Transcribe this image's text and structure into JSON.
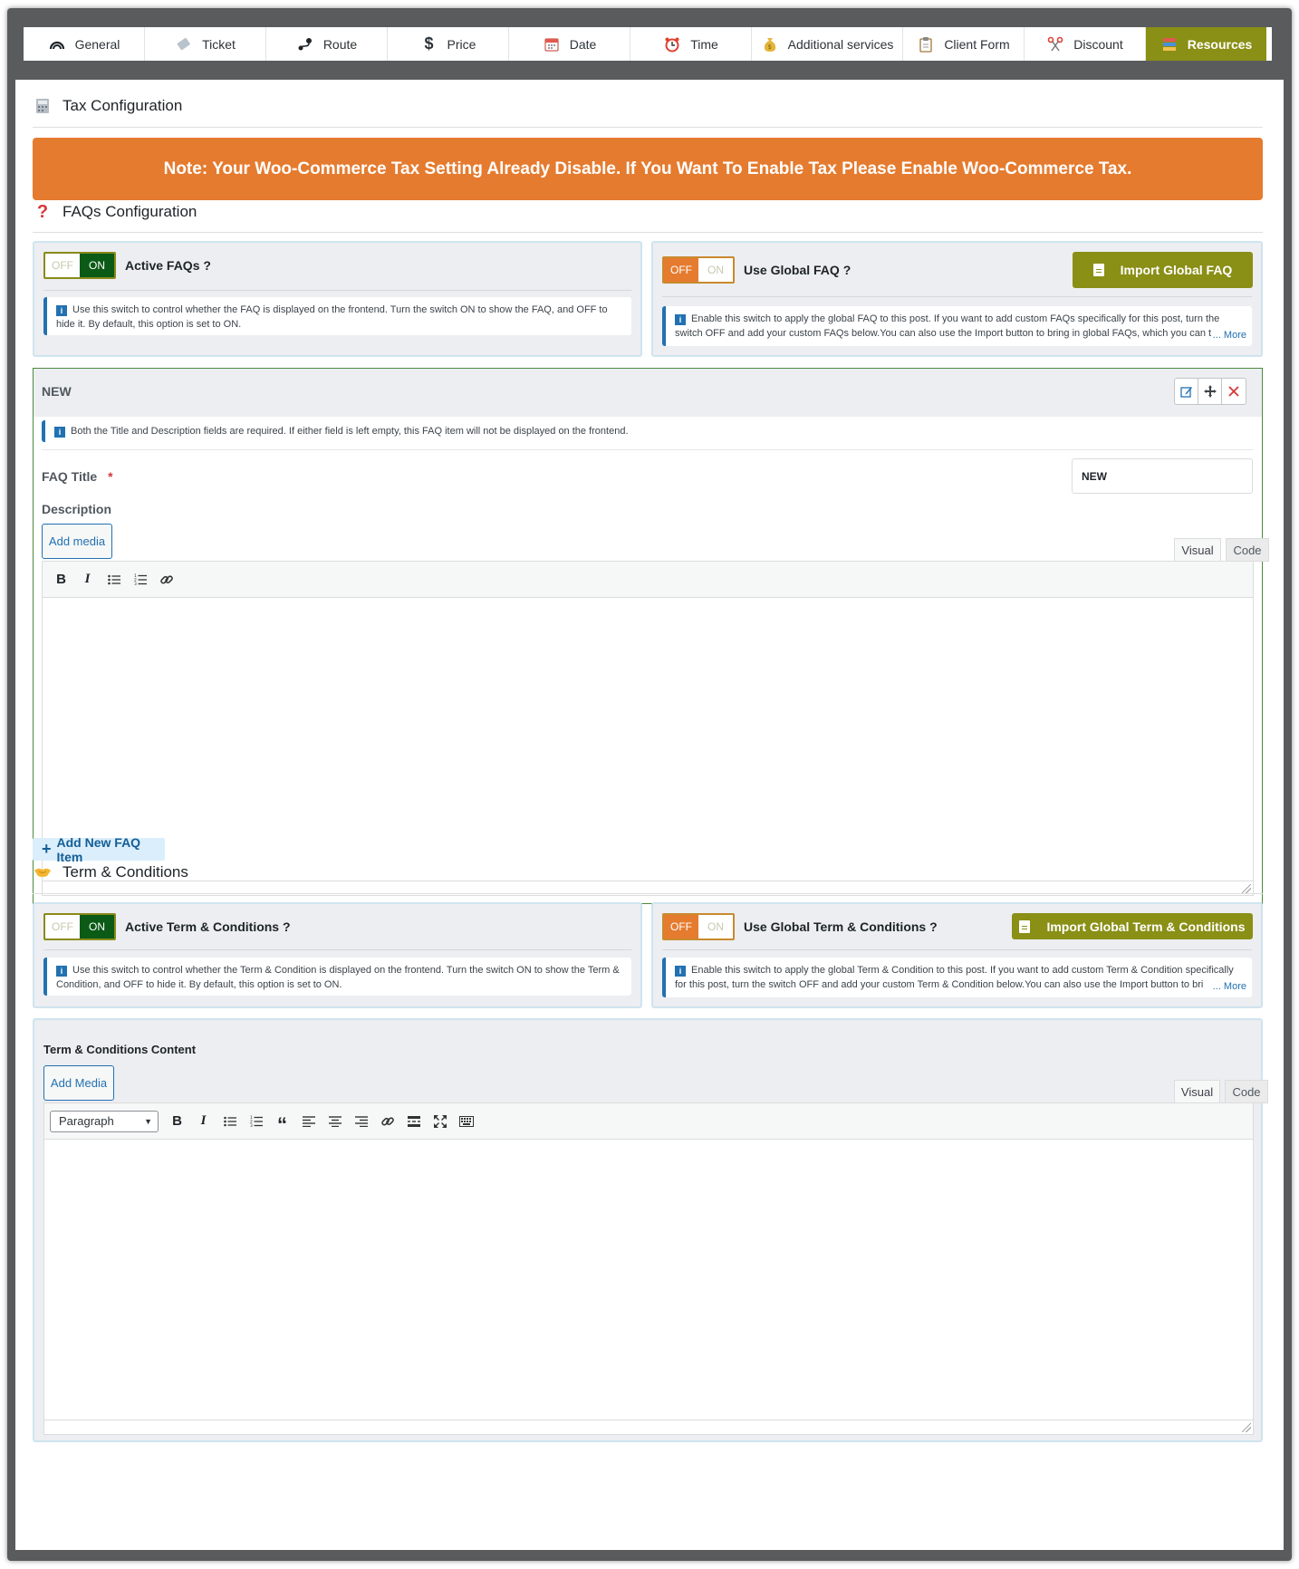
{
  "tabs": [
    {
      "label": "General",
      "icon": "speedometer-icon"
    },
    {
      "label": "Ticket",
      "icon": "ticket-icon"
    },
    {
      "label": "Route",
      "icon": "route-icon"
    },
    {
      "label": "Price",
      "icon": "dollar-icon"
    },
    {
      "label": "Date",
      "icon": "calendar-icon"
    },
    {
      "label": "Time",
      "icon": "alarm-clock-icon"
    },
    {
      "label": "Additional services",
      "icon": "money-bag-icon"
    },
    {
      "label": "Client Form",
      "icon": "clipboard-icon"
    },
    {
      "label": "Discount",
      "icon": "scissors-icon"
    },
    {
      "label": "Resources",
      "icon": "books-icon"
    }
  ],
  "active_tab": "Resources",
  "colors": {
    "active_tab_bg": "#8a8f16",
    "banner_bg": "#e57b2f",
    "toggle_on": "#0b5a16",
    "toggle_off": "#e57b2f",
    "button_olive": "#8a8f16",
    "info_border": "#2271b1"
  },
  "tax": {
    "title": "Tax Configuration",
    "note": "Note: Your Woo-Commerce Tax Setting Already Disable. If You Want To Enable Tax Please Enable Woo-Commerce Tax."
  },
  "faq": {
    "title": "FAQs Configuration",
    "active": {
      "off": "OFF",
      "on": "ON",
      "state": "ON",
      "label": "Active FAQs ?",
      "info": "Use this switch to control whether the FAQ is displayed on the frontend. Turn the switch ON to show the FAQ, and OFF to hide it. By default, this option is set to ON."
    },
    "global": {
      "off": "OFF",
      "on": "ON",
      "state": "OFF",
      "label": "Use Global FAQ ?",
      "button": "Import Global FAQ",
      "info": "Enable this switch to apply the global FAQ to this post. If you want to add custom FAQs specifically for this post, turn the switch OFF and add your custom FAQs below.You can also use the Import button to bring in global FAQs, which you can t",
      "more": "... More"
    },
    "item": {
      "heading": "NEW",
      "info": "Both the Title and Description fields are required. If either field is left empty, this FAQ item will not be displayed on the frontend.",
      "title_label": "FAQ Title",
      "required_mark": "*",
      "title_value": "NEW",
      "description_label": "Description",
      "add_media": "Add media",
      "tab_visual": "Visual",
      "tab_code": "Code"
    },
    "add_item": "Add New FAQ Item"
  },
  "terms": {
    "title": "Term & Conditions",
    "active": {
      "off": "OFF",
      "on": "ON",
      "state": "ON",
      "label": "Active Term & Conditions ?",
      "info": "Use this switch to control whether the Term & Condition is displayed on the frontend. Turn the switch ON to show the Term & Condition, and OFF to hide it. By default, this option is set to ON."
    },
    "global": {
      "off": "OFF",
      "on": "ON",
      "state": "OFF",
      "label": "Use Global Term & Conditions ?",
      "button": "Import Global Term & Conditions",
      "info": "Enable this switch to apply the global Term & Condition to this post. If you want to add custom Term & Condition specifically for this post, turn the switch OFF and add your custom Term & Condition below.You can also use the Import button to bri",
      "more": "... More"
    },
    "content_label": "Term & Conditions Content",
    "add_media": "Add Media",
    "tab_visual": "Visual",
    "tab_code": "Code",
    "format_select": "Paragraph"
  }
}
